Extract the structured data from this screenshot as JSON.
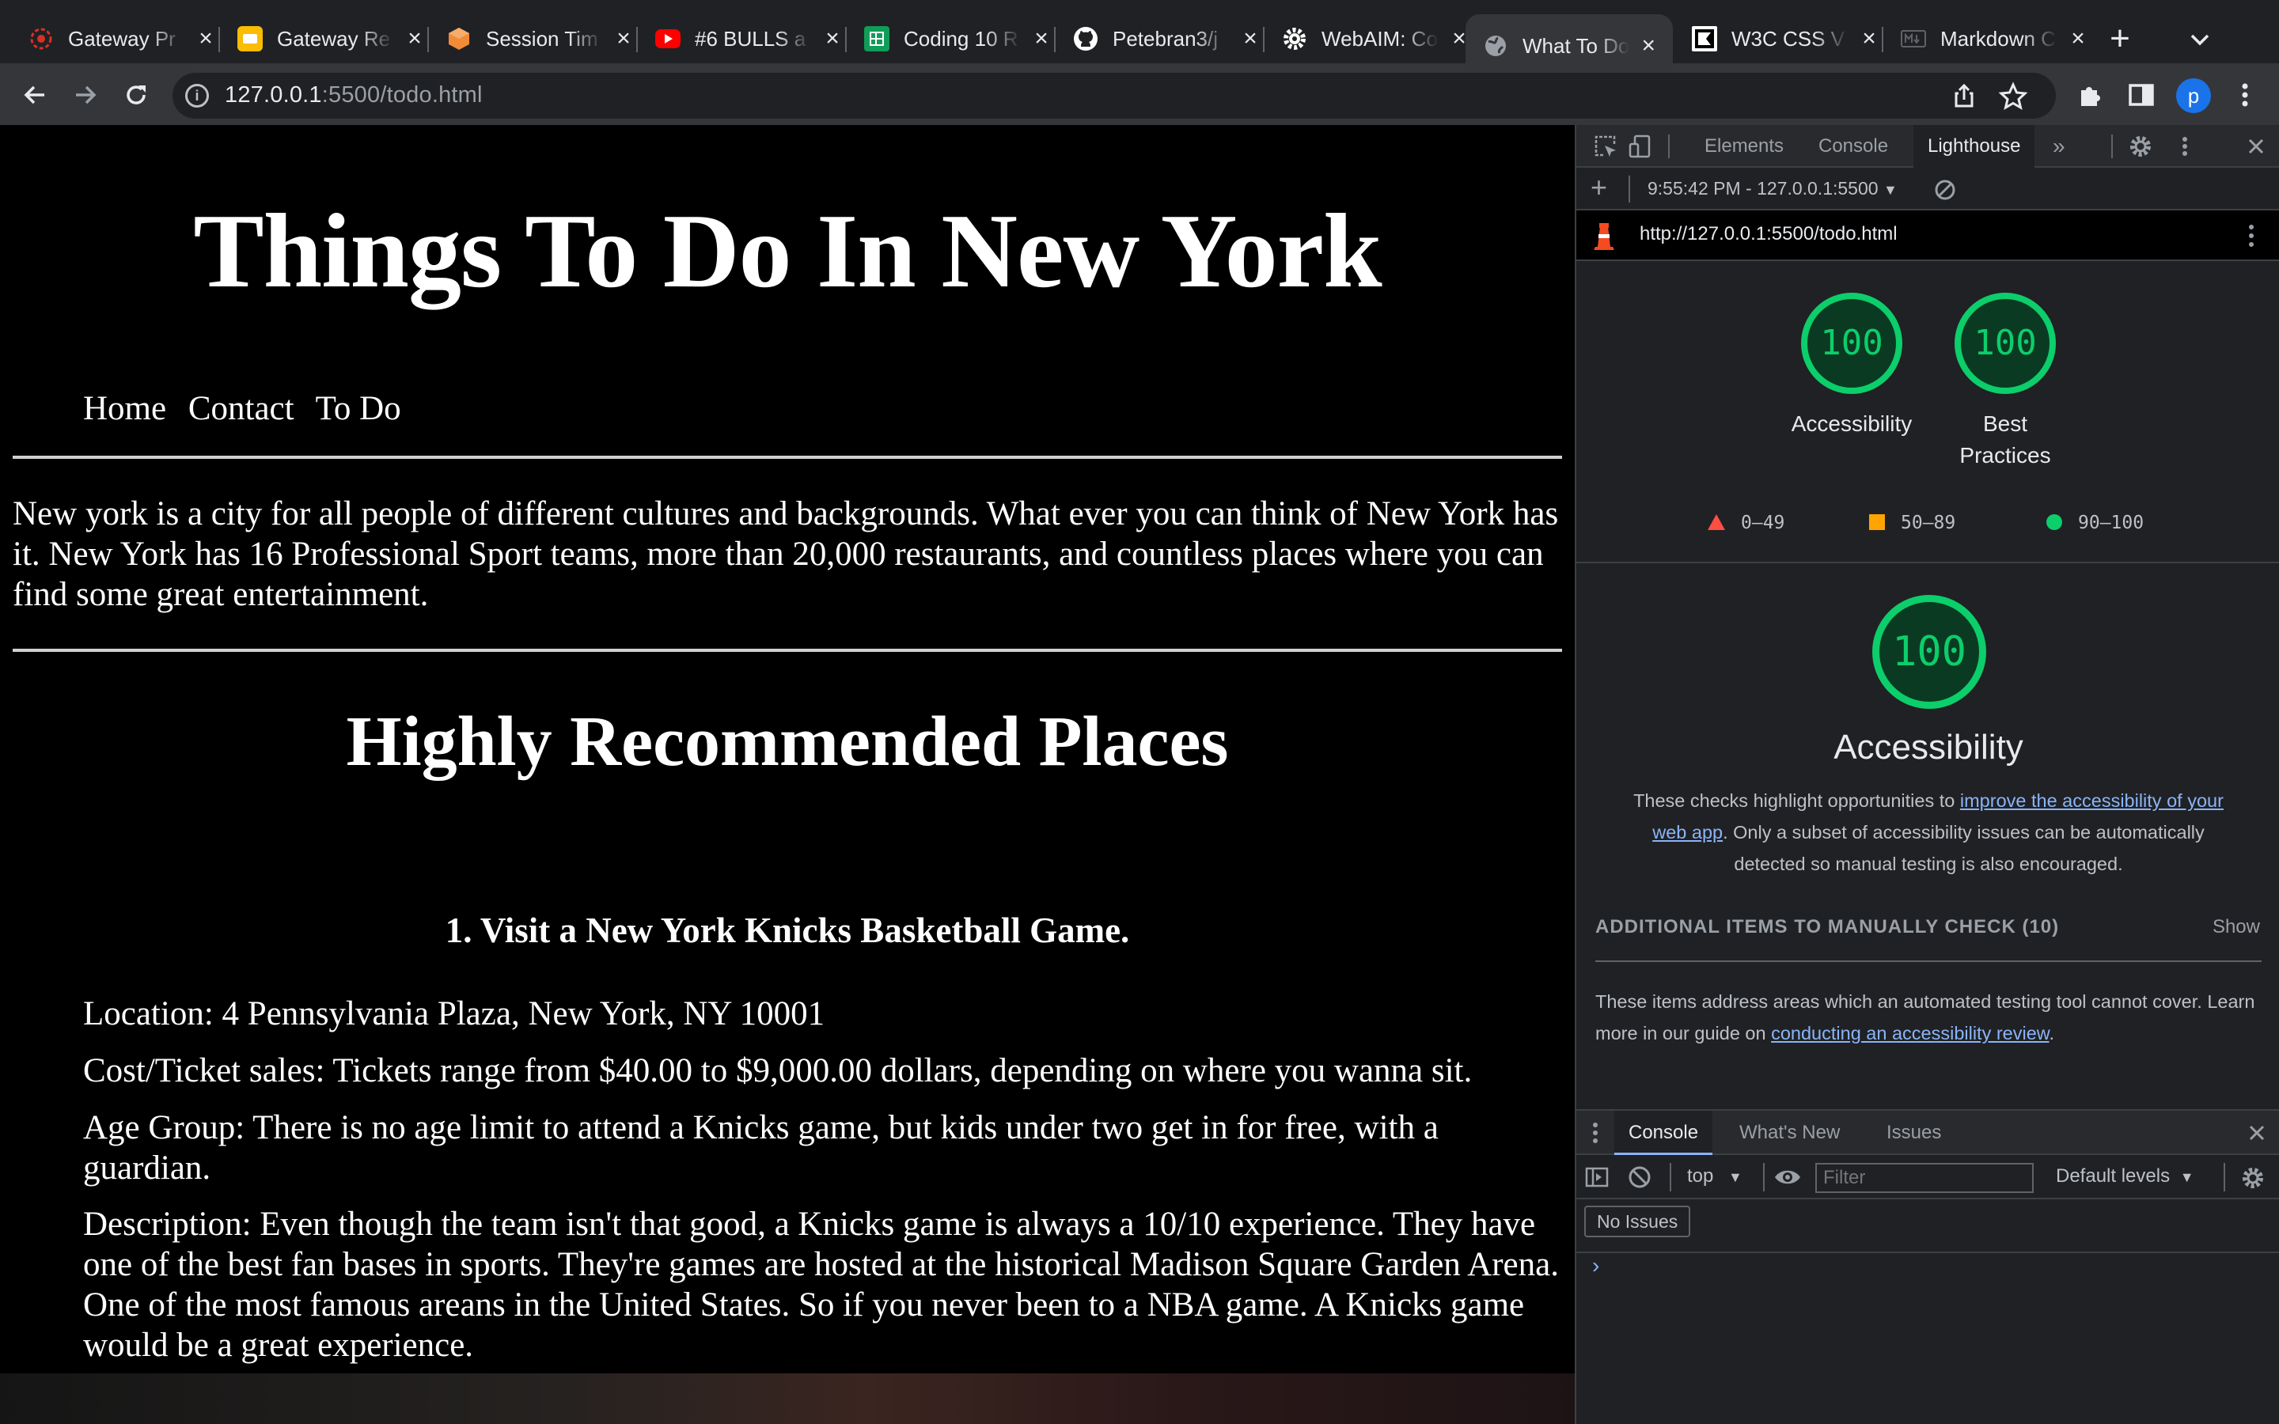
{
  "tabs": [
    {
      "title": "Gateway Pr",
      "icon": "gateway-icon",
      "color": "#d93025"
    },
    {
      "title": "Gateway Re",
      "icon": "slides-icon",
      "color": "#fbbc04"
    },
    {
      "title": "Session Tim",
      "icon": "box-icon",
      "color": "#f28b37"
    },
    {
      "title": "#6 BULLS a",
      "icon": "youtube-icon",
      "color": "#ff0000"
    },
    {
      "title": "Coding 10 R",
      "icon": "sheets-icon",
      "color": "#0f9d58"
    },
    {
      "title": "Petebran3/j",
      "icon": "github-icon",
      "color": "#ffffff"
    },
    {
      "title": "WebAIM: Co",
      "icon": "gear-icon",
      "color": "#ffffff"
    },
    {
      "title": "What To Do",
      "icon": "globe-icon",
      "color": "#9aa0a6"
    },
    {
      "title": "W3C CSS V",
      "icon": "w3c-icon",
      "color": "#000000"
    },
    {
      "title": "Markdown C",
      "icon": "markdown-icon",
      "color": "#5f6368"
    }
  ],
  "browser": {
    "url_host": "127.0.0.1",
    "url_rest": ":5500/todo.html",
    "profile_initial": "p"
  },
  "page": {
    "title": "Things To Do In New York",
    "nav": [
      "Home",
      "Contact",
      "To Do"
    ],
    "intro": "New york is a city for all people of different cultures and backgrounds. What ever you can think of New York has it. New York has 16 Professional Sport teams, more than 20,000 restaurants, and countless places where you can find some great entertainment.",
    "section_title": "Highly Recommended Places",
    "item_title": "1. Visit a New York Knicks Basketball Game.",
    "location": "Location: 4 Pennsylvania Plaza, New York, NY 10001",
    "cost": "Cost/Ticket sales: Tickets range from $40.00 to $9,000.00 dollars, depending on where you wanna sit.",
    "age": "Age Group: There is no age limit to attend a Knicks game, but kids under two get in for free, with a guardian.",
    "description": "Description: Even though the team isn't that good, a Knicks game is always a 10/10 experience. They have one of the best fan bases in sports. They're games are hosted at the historical Madison Square Garden Arena. One of the most famous areans in the United States. So if you never been to a NBA game. A Knicks game would be a great experience."
  },
  "devtools": {
    "tabs": [
      "Elements",
      "Console",
      "Lighthouse"
    ],
    "active_tab": "Lighthouse",
    "report_time": "9:55:42 PM - 127.0.0.1:5500",
    "report_url": "http://127.0.0.1:5500/todo.html",
    "scores": [
      {
        "value": "100",
        "label": "Accessibility"
      },
      {
        "value": "100",
        "label": "Best Practices"
      }
    ],
    "legend": [
      "0–49",
      "50–89",
      "90–100"
    ],
    "main_score": "100",
    "main_label": "Accessibility",
    "desc_pre": "These checks highlight opportunities to ",
    "desc_link": "improve the accessibility of your web app",
    "desc_post": ". Only a subset of accessibility issues can be automatically detected so manual testing is also encouraged.",
    "manual_heading": "ADDITIONAL ITEMS TO MANUALLY CHECK (10)",
    "show_label": "Show",
    "manual_pre": "These items address areas which an automated testing tool cannot cover. Learn more in our guide on ",
    "manual_link": "conducting an accessibility review",
    "manual_post": ".",
    "drawer_tabs": [
      "Console",
      "What's New",
      "Issues"
    ],
    "context": "top",
    "filter_placeholder": "Filter",
    "levels": "Default levels",
    "no_issues": "No Issues"
  },
  "colors": {
    "pass": "#0cce6b",
    "average": "#ffa400",
    "fail": "#ff4e42",
    "link": "#8ab4f8"
  }
}
